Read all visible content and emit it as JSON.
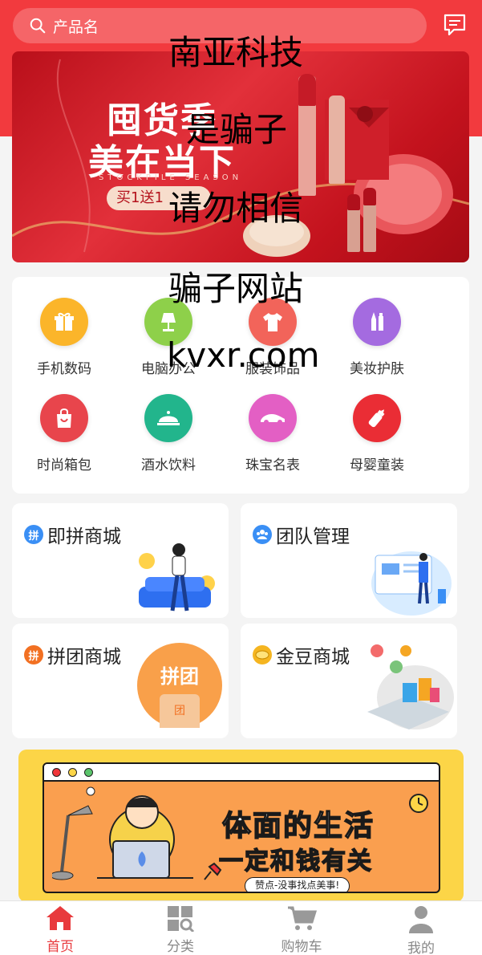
{
  "search": {
    "placeholder": "产品名"
  },
  "header_icons": {
    "search": "search-icon",
    "message": "message-icon"
  },
  "banner": {
    "line1": "囤货季",
    "line2": "美在当下",
    "subtitle": "STOCKPILE SEASON",
    "tag": "买1送1"
  },
  "categories": [
    {
      "label": "手机数码",
      "icon": "gift-icon",
      "color": "#fbb52a"
    },
    {
      "label": "电脑办公",
      "icon": "lamp-icon",
      "color": "#8ed04a"
    },
    {
      "label": "服装饰品",
      "icon": "tshirt-icon",
      "color": "#f2645a"
    },
    {
      "label": "美妆护肤",
      "icon": "cosmetics-icon",
      "color": "#a46be0"
    },
    {
      "label": "时尚箱包",
      "icon": "bag-icon",
      "color": "#e8454c"
    },
    {
      "label": "酒水饮料",
      "icon": "food-cover-icon",
      "color": "#22b58c"
    },
    {
      "label": "珠宝名表",
      "icon": "car-icon",
      "color": "#e35fc4"
    },
    {
      "label": "母婴童装",
      "icon": "bottle-icon",
      "color": "#ea2d35"
    }
  ],
  "tiles": [
    {
      "title": "即拼商城",
      "badge": "拼",
      "badge_color": "#3a8ff5"
    },
    {
      "title": "团队管理",
      "badge": "",
      "badge_color": "#3a8ff5"
    },
    {
      "title": "拼团商城",
      "badge": "拼",
      "badge_color": "#f27022",
      "art_text": "拼团",
      "art_sub": "团"
    },
    {
      "title": "金豆商城",
      "badge": "",
      "badge_color": "#f5b520"
    }
  ],
  "promo": {
    "line1": "体面的生活",
    "line2": "一定和钱有关",
    "tagline": "赞点-没事找点美事!"
  },
  "tabbar": [
    {
      "label": "首页",
      "icon": "home-icon",
      "active": true
    },
    {
      "label": "分类",
      "icon": "category-icon",
      "active": false
    },
    {
      "label": "购物车",
      "icon": "cart-icon",
      "active": false
    },
    {
      "label": "我的",
      "icon": "user-icon",
      "active": false
    }
  ],
  "overlay_text": [
    "南亚科技",
    "是骗子",
    "请勿相信",
    "骗子网站",
    "kvxr.com"
  ],
  "colors": {
    "accent": "#f23a3e",
    "tab_active": "#e83a3d",
    "tab_inactive": "#888888"
  }
}
